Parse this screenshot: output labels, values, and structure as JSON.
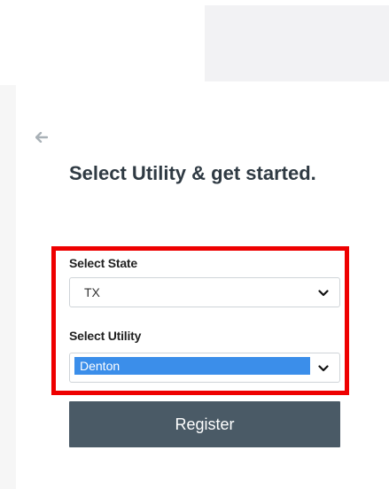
{
  "header": {
    "back_icon": "arrow-left-icon"
  },
  "form": {
    "title": "Select Utility & get started.",
    "state_label": "Select State",
    "state_value": "TX",
    "utility_label": "Select Utility",
    "utility_value": "Denton",
    "chevron_icon": "chevron-down-icon",
    "register_label": "Register"
  },
  "colors": {
    "accent_box": "#ee0000",
    "button_bg": "#4a5a66",
    "selection_highlight": "#3b8eea",
    "heading_text": "#2f3a43"
  }
}
